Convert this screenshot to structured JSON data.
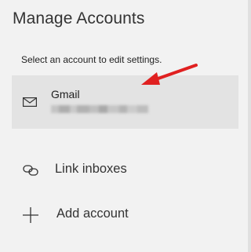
{
  "header": {
    "title": "Manage Accounts"
  },
  "accounts_section": {
    "hint": "Select an account to edit settings.",
    "accounts": [
      {
        "name": "Gmail",
        "icon": "mail-icon"
      }
    ]
  },
  "actions": {
    "link_inboxes": {
      "label": "Link inboxes",
      "icon": "link-icon"
    },
    "add_account": {
      "label": "Add account",
      "icon": "plus-icon"
    }
  },
  "annotation": {
    "arrow_color": "#e02020"
  },
  "colors": {
    "panel_bg": "#f2f2f2",
    "selected_bg": "#e3e3e3",
    "text": "#333333"
  }
}
